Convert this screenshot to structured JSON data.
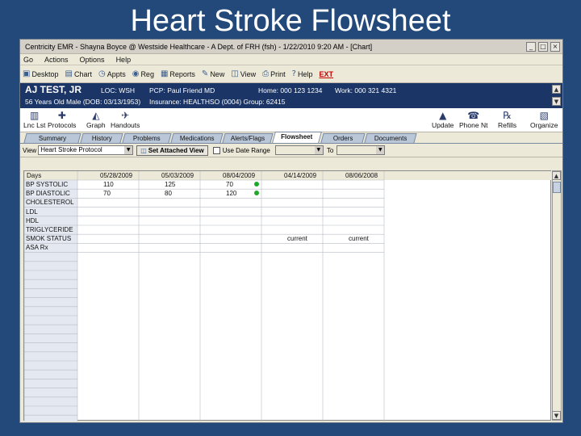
{
  "slide_title": "Heart Stroke Flowsheet",
  "window": {
    "title": "Centricity EMR - Shayna Boyce @ Westside Healthcare - A Dept. of FRH (fsh) - 1/22/2010 9:20 AM - [Chart]",
    "controls": [
      "_",
      "□",
      "×"
    ]
  },
  "menu": [
    "Go",
    "Actions",
    "Options",
    "Help"
  ],
  "toolbar": [
    {
      "icon": "desktop-icon",
      "glyph": "▣",
      "label": "Desktop"
    },
    {
      "icon": "chart-icon",
      "glyph": "▤",
      "label": "Chart"
    },
    {
      "icon": "appts-icon",
      "glyph": "◷",
      "label": "Appts"
    },
    {
      "icon": "reg-icon",
      "glyph": "◉",
      "label": "Reg"
    },
    {
      "icon": "reports-icon",
      "glyph": "▦",
      "label": "Reports"
    },
    {
      "icon": "new-icon",
      "glyph": "✎",
      "label": "New"
    },
    {
      "icon": "view-icon",
      "glyph": "◫",
      "label": "View"
    },
    {
      "icon": "print-icon",
      "glyph": "⎙",
      "label": "Print"
    },
    {
      "icon": "help-icon",
      "glyph": "?",
      "label": "Help"
    },
    {
      "icon": "",
      "glyph": "",
      "label": "EXT"
    }
  ],
  "patient": {
    "name": "AJ TEST, JR",
    "loc": "LOC: WSH",
    "pcp": "PCP: Paul Friend MD",
    "home": "Home: 000 123 1234",
    "work": "Work: 000 321 4321",
    "demo": "56 Years Old Male (DOB: 03/13/1953)",
    "insurance": "Insurance: HEALTHSO (0004) Group: 62415"
  },
  "iconbar_left": [
    {
      "icon": "list-icon",
      "glyph": "▥",
      "label": "Lnc Lst"
    },
    {
      "icon": "protocols-icon",
      "glyph": "✚",
      "label": "Protocols"
    },
    {
      "icon": "graph-icon",
      "glyph": "◭",
      "label": "Graph"
    },
    {
      "icon": "handouts-icon",
      "glyph": "✈",
      "label": "Handouts"
    }
  ],
  "iconbar_right": [
    {
      "icon": "update-icon",
      "glyph": "▲",
      "label": "Update"
    },
    {
      "icon": "phone-note-icon",
      "glyph": "☎",
      "label": "Phone Nt"
    },
    {
      "icon": "refills-icon",
      "glyph": "℞",
      "label": "Refills"
    },
    {
      "icon": "organize-icon",
      "glyph": "▧",
      "label": "Organize"
    }
  ],
  "tabs": [
    "Summary",
    "History",
    "Problems",
    "Medications",
    "Alerts/Flags",
    "Flowsheet",
    "Orders",
    "Documents"
  ],
  "active_tab": "Flowsheet",
  "viewbar": {
    "view_label": "View",
    "view_value": "Heart Stroke Protocol",
    "set_button": "Set Attached View",
    "date_range_label": "Use Date Range",
    "to_label": "To"
  },
  "grid": {
    "corner_label": "Days",
    "dates": [
      "05/28/2009",
      "05/03/2009",
      "08/04/2009",
      "04/14/2009",
      "08/06/2008"
    ],
    "rows": [
      {
        "label": "BP SYSTOLIC",
        "values": [
          "110",
          "125",
          "70",
          "",
          ""
        ],
        "flag": true
      },
      {
        "label": "BP DIASTOLIC",
        "values": [
          "70",
          "80",
          "120",
          "",
          ""
        ],
        "flag": true
      },
      {
        "label": "CHOLESTEROL",
        "values": [
          "",
          "",
          "",
          "",
          ""
        ],
        "flag": false
      },
      {
        "label": "LDL",
        "values": [
          "",
          "",
          "",
          "",
          ""
        ],
        "flag": false
      },
      {
        "label": "HDL",
        "values": [
          "",
          "",
          "",
          "",
          ""
        ],
        "flag": false
      },
      {
        "label": "TRIGLYCERIDE",
        "values": [
          "",
          "",
          "",
          "",
          ""
        ],
        "flag": false
      },
      {
        "label": "SMOK STATUS",
        "values": [
          "",
          "",
          "",
          "current",
          "current"
        ],
        "flag": false
      },
      {
        "label": "ASA Rx",
        "values": [
          "",
          "",
          "",
          "",
          ""
        ],
        "flag": false
      }
    ],
    "flag_color": "#1fa82a"
  }
}
